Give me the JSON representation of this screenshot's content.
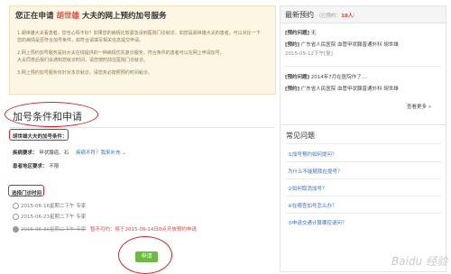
{
  "notice": {
    "prefix": "您正在申请",
    "doctor": "胡世雄",
    "suffix": "大夫的网上预约加号服务",
    "lines": [
      "1.胡世雄大夫看患者，您也心情不好？如果您的病情比较紧急请到医院门诊就诊，如您是胡世雄大夫的患者，可以对比一下",
      "   您的病情是否符合加号条件，如符合请填写相关信息提交申请。",
      "2.网上预约加号服务是好大夫在线提供的一种病情优先复诊服务，符合条件的患者可以在网上申请加号。",
      "   大夫同意后我们会通知您就诊时间，请您按时前往医院门诊就诊。",
      "3.网上预约加号服务仅针对本次就诊，请您务必按照预约时间就诊。"
    ]
  },
  "form": {
    "section_title": "加号条件和申请",
    "condition_label": "胡世雄大夫的加号条件：",
    "disease_label": "疾病要求：",
    "disease_value": "甲状腺癌、石",
    "disease_link": "疾病不符？我来补充 ⌄",
    "region_label": "患者地区要求：",
    "region_value": "不限",
    "time_label": "选择门诊时间",
    "times": [
      {
        "label": "2015-06-16星期二下午 专家",
        "state": "unchecked"
      },
      {
        "label": "2015-06-23星期二下午 专家",
        "state": "unchecked"
      },
      {
        "label": "2015-06-30星期二下午 专家",
        "state": "checked",
        "note": "暂不可约：将于2015-06-14日0点开放预约申请"
      }
    ],
    "submit": "申请"
  },
  "sidebar": {
    "title": "最新预约",
    "count_prefix": "（已预约：",
    "count": "18人",
    "items": [
      {
        "label": "[预约问题]",
        "text": "无"
      },
      {
        "label": "[预约]",
        "text": "广东省人民医院 血管甲状腺普通外科 胡世雄"
      },
      {
        "label": "",
        "text": "2015-05-12下午[复]"
      },
      {
        "label": "[预约问题]",
        "text": "2014年7月在医院作了..."
      },
      {
        "label": "[预约]",
        "text": "广东省人民医院 血管甲状腺普通外科 胡世雄"
      }
    ],
    "more": "查看更多 »"
  },
  "faq": {
    "title": "常见问题",
    "items": [
      "①加号预约如何提问？",
      "为什么不能随我在提号？",
      "②如何取消加号？",
      "④在哪查加号怎么办？",
      "⑤申请交通计算哪控请问？"
    ]
  },
  "watermark": "Baidu 经验",
  "colors": {
    "accent_red": "#e4473b",
    "link_blue": "#3b6fb6",
    "submit_green": "#6cb944",
    "notice_bg": "#fdf6e4"
  }
}
